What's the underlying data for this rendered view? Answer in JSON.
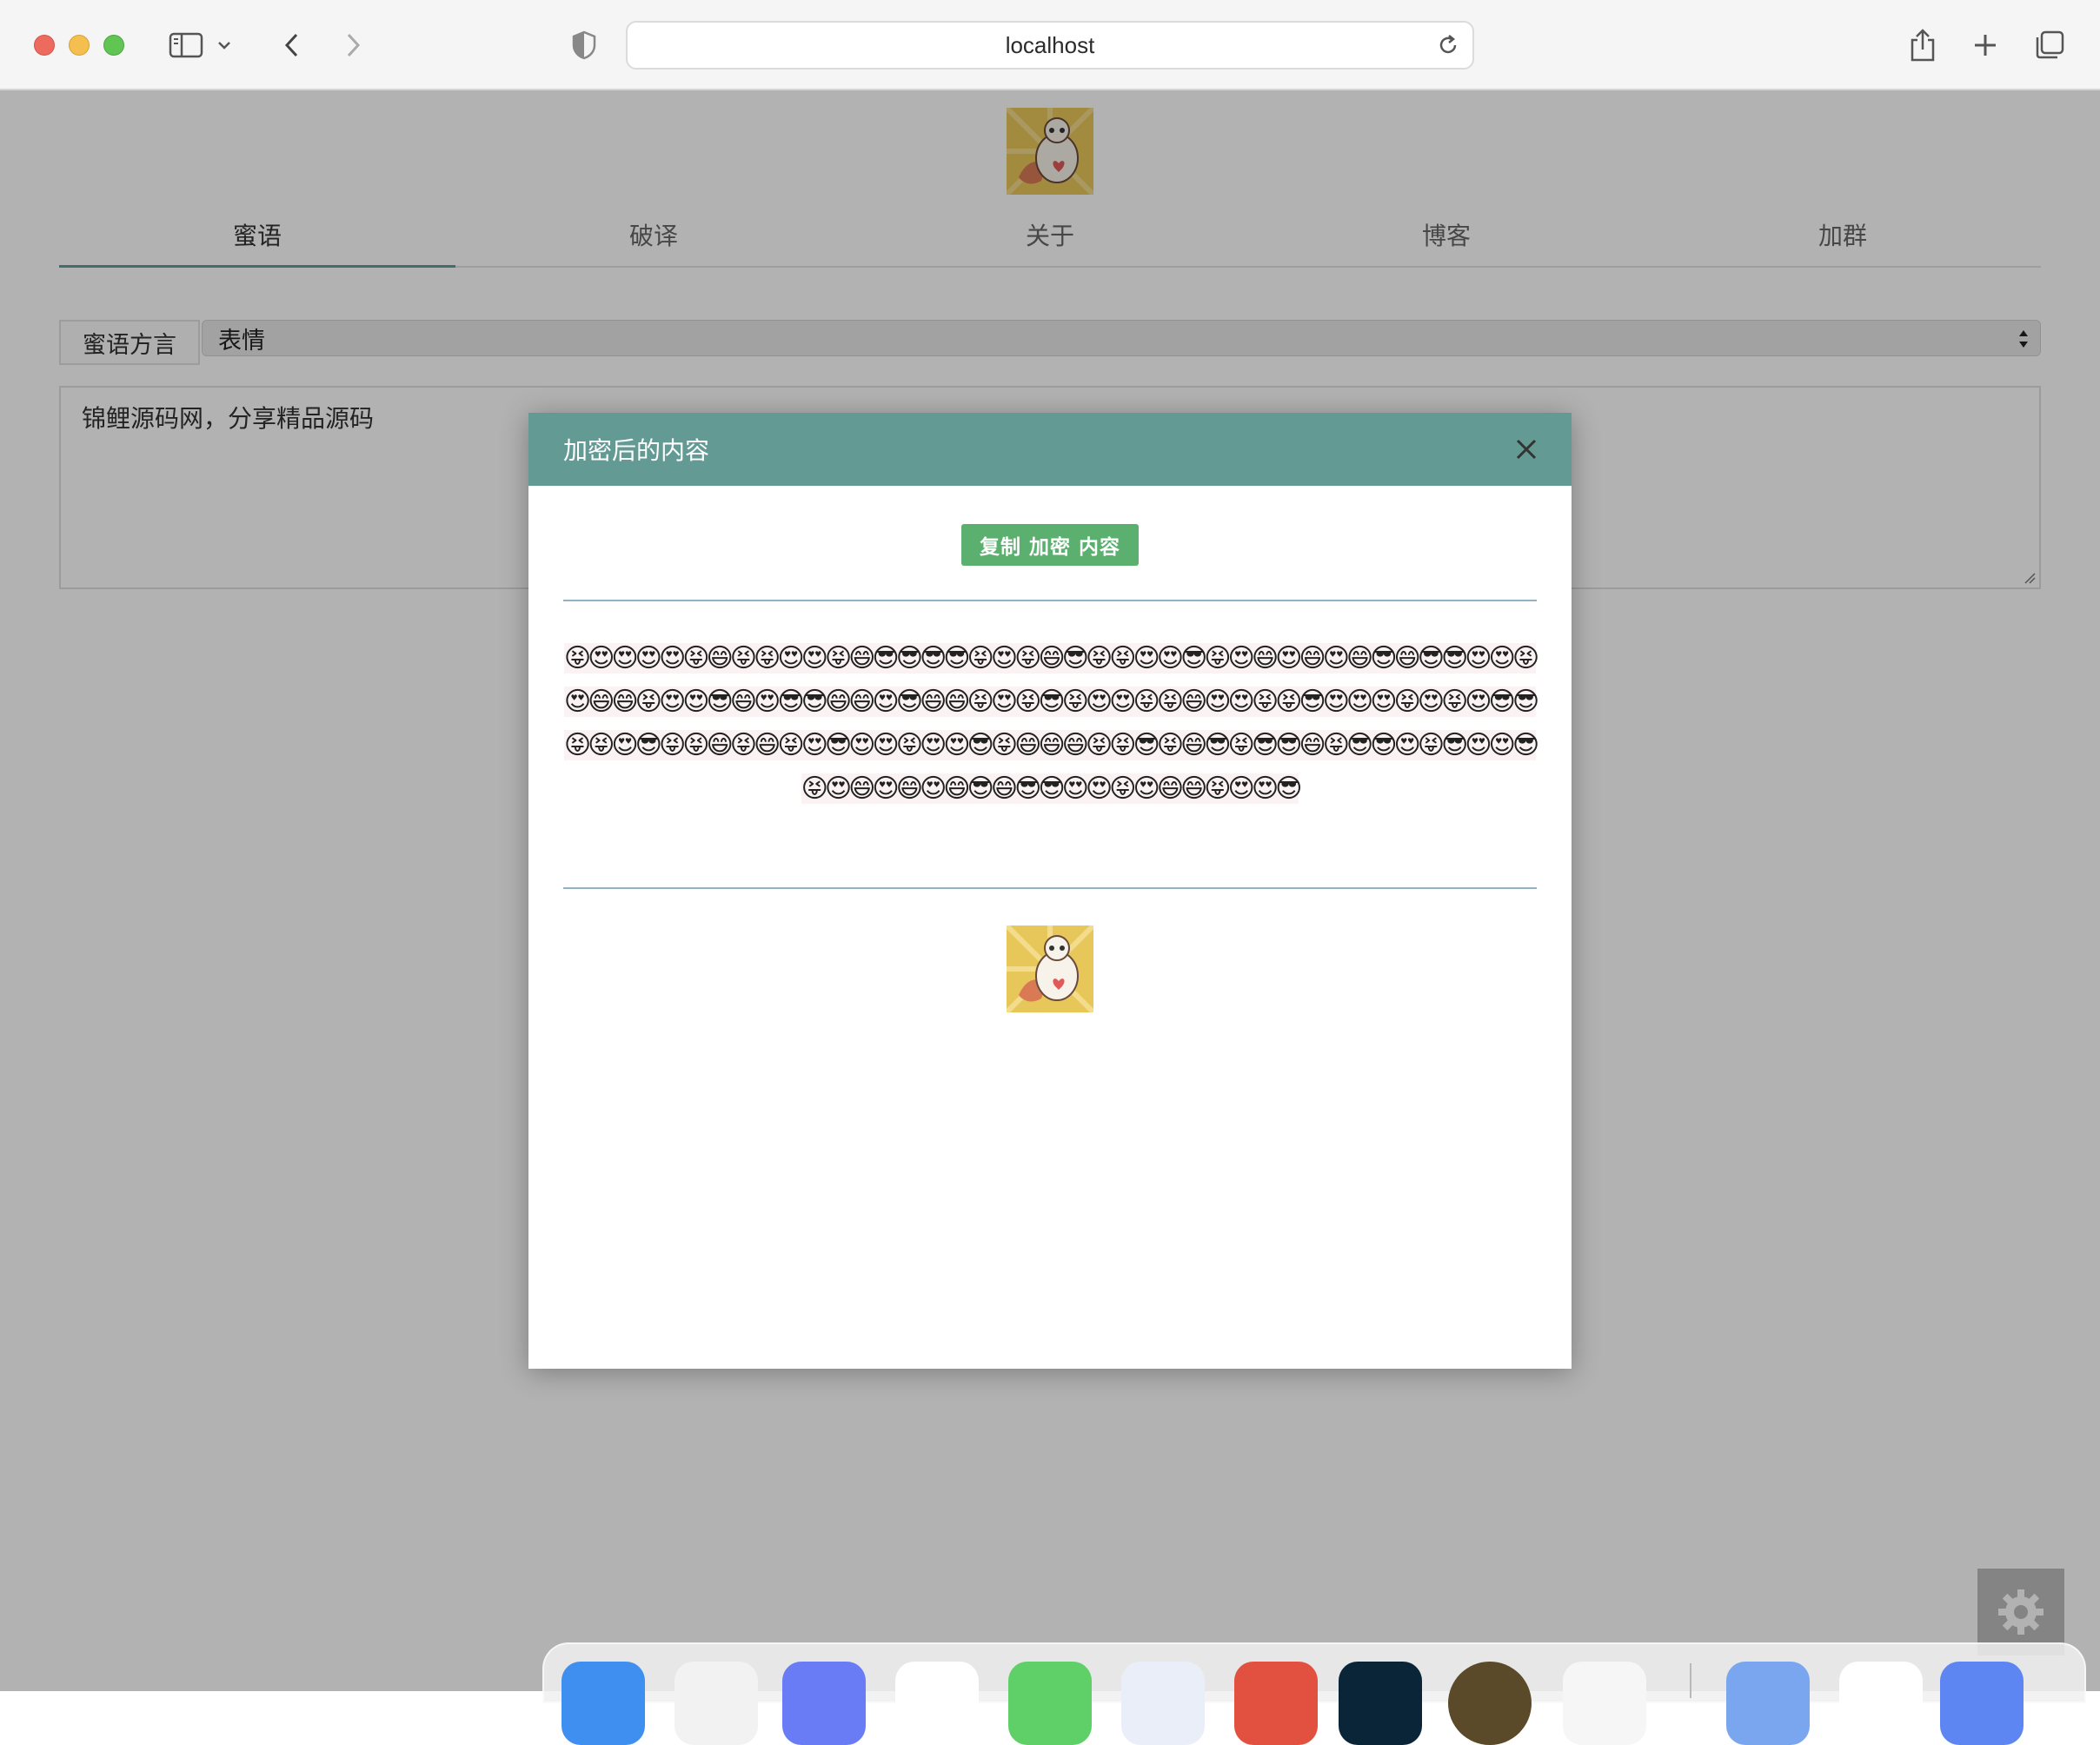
{
  "browser": {
    "url": "localhost"
  },
  "nav": {
    "tabs": [
      {
        "label": "蜜语",
        "active": true
      },
      {
        "label": "破译",
        "active": false
      },
      {
        "label": "关于",
        "active": false
      },
      {
        "label": "博客",
        "active": false
      },
      {
        "label": "加群",
        "active": false
      }
    ]
  },
  "form": {
    "dialect_label": "蜜语方言",
    "dialect_value": "表情",
    "input_text": "锦鲤源码网，分享精品源码"
  },
  "modal": {
    "title": "加密后的内容",
    "copy_button": "复制 加密 内容",
    "encrypted": "😝😍😍😍😍😝😄😝😝😍😍😝😄😎😎😎😎😝😍😝😄😎😝😝😍😍😎😝😍😄😍😄😍😄😎😄😎😎😍😍😝😍😄😄😝😍😍😎😄😍😎😎😄😄😍😎😄😄😝😍😝😎😝😍😍😝😝😄😍😍😝😝😎😍😍😍😝😍😝😍😎😎😝😝😍😎😝😝😄😝😄😝😍😎😍😍😝😍😍😎😝😄😄😄😝😝😎😝😄😎😝😎😎😄😝😎😎😍😝😎😍😍😎😝😍😄😍😄😍😄😎😄😎😎😍😍😝😍😄😄😝😍😍😎"
  },
  "icons": {
    "gear": "gear-icon",
    "close": "close-icon"
  },
  "colors": {
    "accent": "#649a94",
    "copy_button": "#5bb070",
    "divider": "#8fb3c4"
  }
}
